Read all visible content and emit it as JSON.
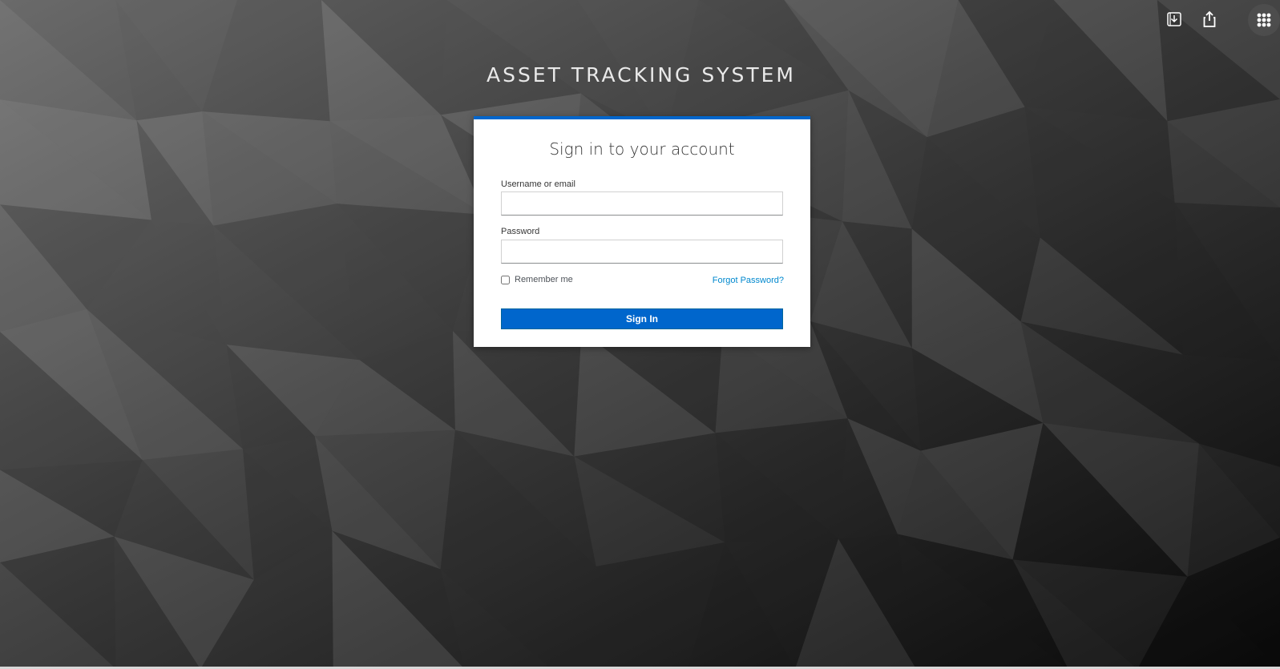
{
  "brand": {
    "title": "ASSET TRACKING SYSTEM"
  },
  "login": {
    "heading": "Sign in to your account",
    "username_label": "Username or email",
    "username_value": "",
    "password_label": "Password",
    "password_value": "",
    "remember_label": "Remember me",
    "remember_checked": false,
    "forgot_link": "Forgot Password?",
    "submit_label": "Sign In"
  },
  "toolbar": {
    "icons": [
      "import-icon",
      "share-icon",
      "apps-grid-icon"
    ]
  },
  "colors": {
    "accent": "#0066cc",
    "link": "#0088ce",
    "card_bg": "#ffffff",
    "background_light": "#6d6d6d",
    "background_dark": "#0d0d0d"
  }
}
